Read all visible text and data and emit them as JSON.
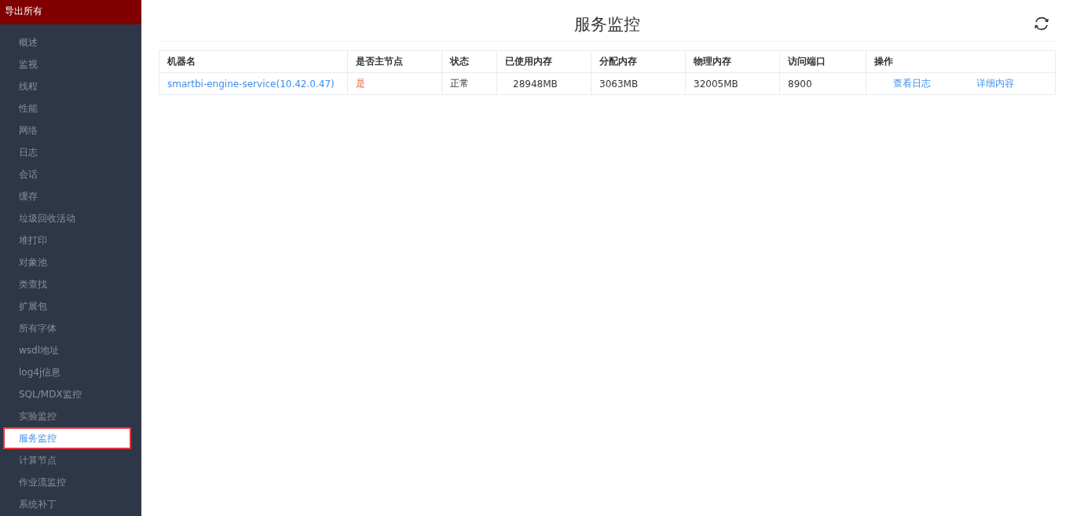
{
  "sidebar": {
    "header": "导出所有",
    "items": [
      {
        "label": "概述",
        "selected": false
      },
      {
        "label": "监视",
        "selected": false
      },
      {
        "label": "线程",
        "selected": false
      },
      {
        "label": "性能",
        "selected": false
      },
      {
        "label": "网络",
        "selected": false
      },
      {
        "label": "日志",
        "selected": false
      },
      {
        "label": "会话",
        "selected": false
      },
      {
        "label": "缓存",
        "selected": false
      },
      {
        "label": "垃圾回收活动",
        "selected": false
      },
      {
        "label": "堆打印",
        "selected": false
      },
      {
        "label": "对象池",
        "selected": false
      },
      {
        "label": "类查找",
        "selected": false
      },
      {
        "label": "扩展包",
        "selected": false
      },
      {
        "label": "所有字体",
        "selected": false
      },
      {
        "label": "wsdl地址",
        "selected": false
      },
      {
        "label": "log4j信息",
        "selected": false
      },
      {
        "label": "SQL/MDX监控",
        "selected": false
      },
      {
        "label": "实验监控",
        "selected": false
      },
      {
        "label": "服务监控",
        "selected": true
      },
      {
        "label": "计算节点",
        "selected": false
      },
      {
        "label": "作业流监控",
        "selected": false
      },
      {
        "label": "系统补丁",
        "selected": false
      }
    ]
  },
  "main": {
    "title": "服务监控",
    "table": {
      "columns": [
        "机器名",
        "是否主节点",
        "状态",
        "已使用内存",
        "分配内存",
        "物理内存",
        "访问端口",
        "操作"
      ],
      "rows": [
        {
          "machine": "smartbi-engine-service(10.42.0.47)",
          "is_master": "是",
          "status": "正常",
          "used_memory": "28948MB",
          "allocated_memory": "3063MB",
          "physical_memory": "32005MB",
          "port": "8900",
          "actions": [
            "查看日志",
            "详细内容"
          ]
        }
      ]
    }
  }
}
